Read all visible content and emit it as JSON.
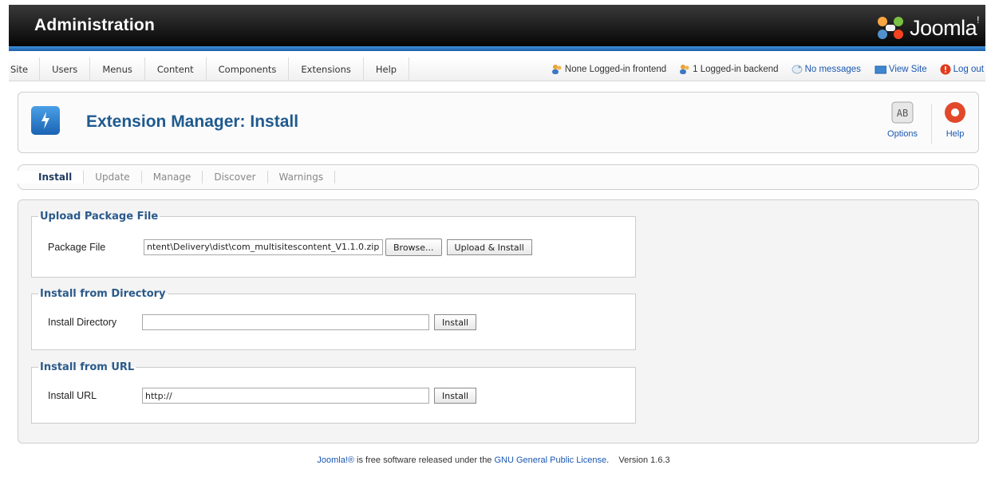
{
  "header": {
    "title": "Administration",
    "brand": "Joomla!",
    "brand_main": "Joomla",
    "brand_mark": "!"
  },
  "menu": {
    "items": [
      "Site",
      "Users",
      "Menus",
      "Content",
      "Components",
      "Extensions",
      "Help"
    ]
  },
  "status": {
    "frontend": "None Logged-in frontend",
    "backend": "1 Logged-in backend",
    "messages": "No messages",
    "view_site": "View Site",
    "logout": "Log out"
  },
  "toolbar": {
    "page_title": "Extension Manager: Install",
    "options_label": "Options",
    "help_label": "Help"
  },
  "submenu": {
    "tabs": [
      "Install",
      "Update",
      "Manage",
      "Discover",
      "Warnings"
    ],
    "active": "Install"
  },
  "upload": {
    "legend": "Upload Package File",
    "label": "Package File",
    "value": "ntent\\Delivery\\dist\\com_multisitescontent_V1.1.0.zip",
    "browse_label": "Browse...",
    "submit_label": "Upload & Install"
  },
  "directory": {
    "legend": "Install from Directory",
    "label": "Install Directory",
    "value": "",
    "submit_label": "Install"
  },
  "url": {
    "legend": "Install from URL",
    "label": "Install URL",
    "value": "http://",
    "submit_label": "Install"
  },
  "footer": {
    "brand_text": "Joomla!®",
    "text1": " is free software released under the ",
    "license_link": "GNU General Public License",
    "text2": ".",
    "version": "Version 1.6.3"
  },
  "colors": {
    "title_blue": "#1f5a8f",
    "link_blue": "#1b57b1",
    "legend_blue": "#2b5a8a"
  }
}
